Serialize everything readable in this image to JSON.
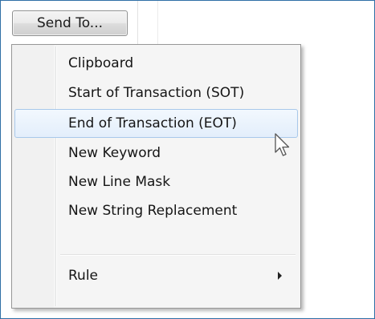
{
  "button": {
    "label": "Send To..."
  },
  "menu": {
    "items": [
      {
        "label": "Clipboard"
      },
      {
        "label": "Start of Transaction (SOT)"
      },
      {
        "label": "End of Transaction (EOT)",
        "highlighted": true
      },
      {
        "label": "New Keyword"
      },
      {
        "label": "New Line Mask"
      },
      {
        "label": "New String Replacement"
      },
      {
        "label": "Rule",
        "has_submenu": true
      }
    ]
  },
  "icons": {
    "submenu_arrow": "chevron-right-icon",
    "cursor": "mouse-pointer-icon"
  },
  "colors": {
    "frame_border": "#2f6fa6",
    "highlight_border": "#a8c8ea",
    "highlight_fill": "#e3eefb",
    "menu_background": "#f5f5f5"
  }
}
